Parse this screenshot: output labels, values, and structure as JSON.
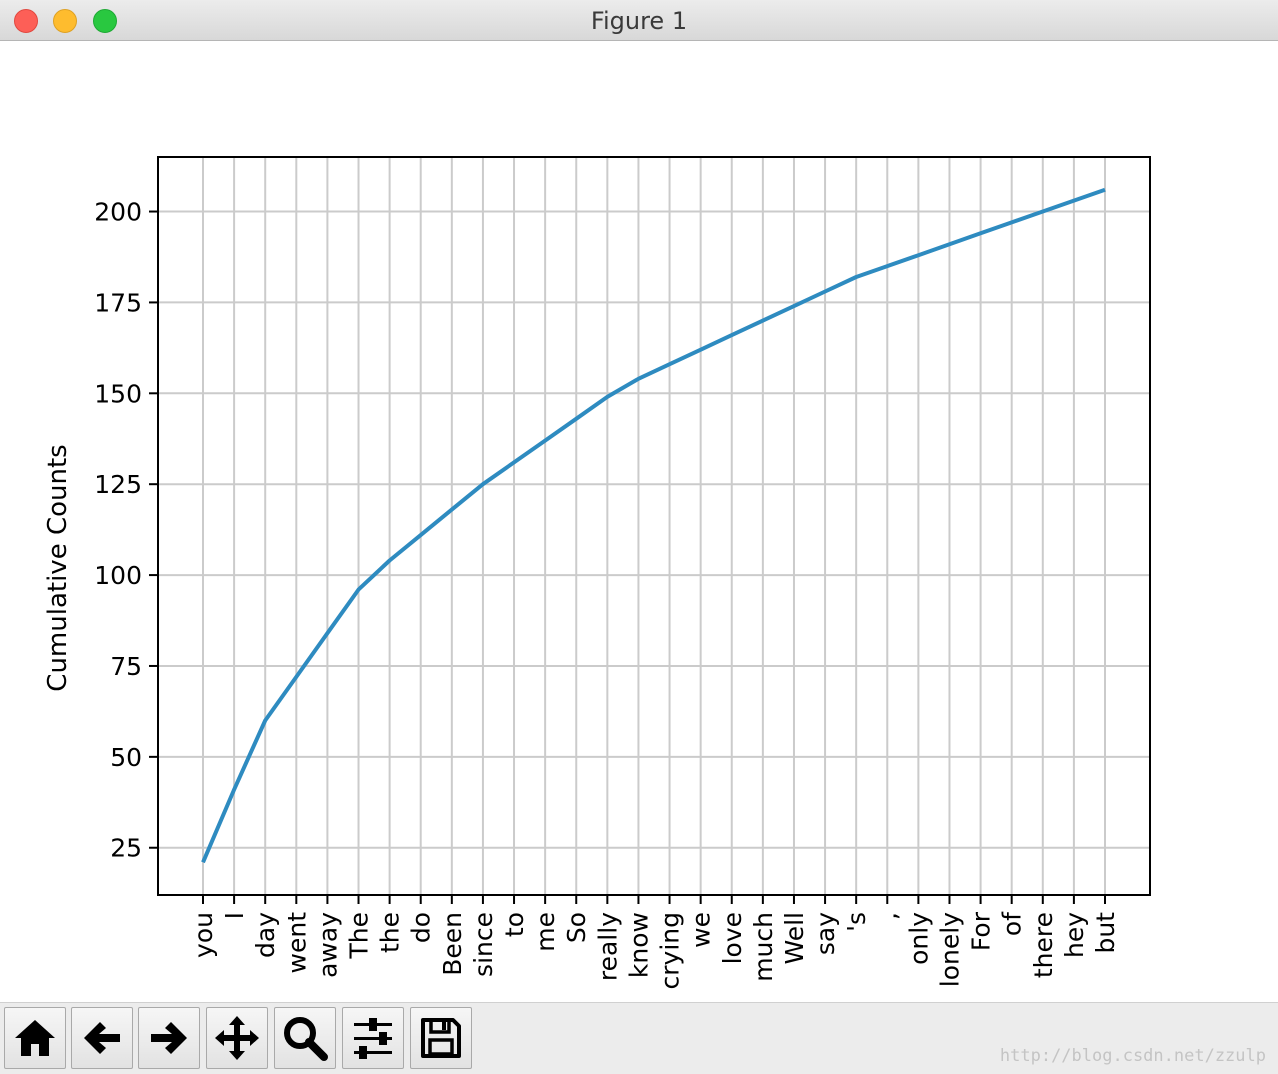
{
  "window": {
    "title": "Figure 1"
  },
  "chart_data": {
    "type": "line",
    "categories": [
      "you",
      "I",
      "day",
      "went",
      "away",
      "The",
      "the",
      "do",
      "Been",
      "since",
      "to",
      "me",
      "So",
      "really",
      "know",
      "crying",
      "we",
      "love",
      "much",
      "Well",
      "say",
      "'s",
      ",",
      "only",
      "lonely",
      "For",
      "of",
      "there",
      "hey",
      "but"
    ],
    "values": [
      21,
      41,
      60,
      72,
      84,
      96,
      104,
      111,
      118,
      125,
      131,
      137,
      143,
      149,
      154,
      158,
      162,
      166,
      170,
      174,
      178,
      182,
      185,
      188,
      191,
      194,
      197,
      200,
      203,
      206
    ],
    "ylabel": "Cumulative Counts",
    "xlabel": "",
    "ylim": [
      12,
      215
    ],
    "yticks": [
      25,
      50,
      75,
      100,
      125,
      150,
      175,
      200
    ],
    "grid": true,
    "line_color": "#2e8bc0"
  },
  "toolbar": {
    "buttons": [
      {
        "name": "home-button",
        "icon": "home-icon"
      },
      {
        "name": "back-button",
        "icon": "arrow-left-icon"
      },
      {
        "name": "forward-button",
        "icon": "arrow-right-icon"
      },
      {
        "name": "pan-button",
        "icon": "move-icon"
      },
      {
        "name": "zoom-button",
        "icon": "magnifier-icon"
      },
      {
        "name": "configure-subplots-button",
        "icon": "sliders-icon"
      },
      {
        "name": "save-button",
        "icon": "floppy-disk-icon"
      }
    ]
  },
  "watermark": "http://blog.csdn.net/zzulp"
}
